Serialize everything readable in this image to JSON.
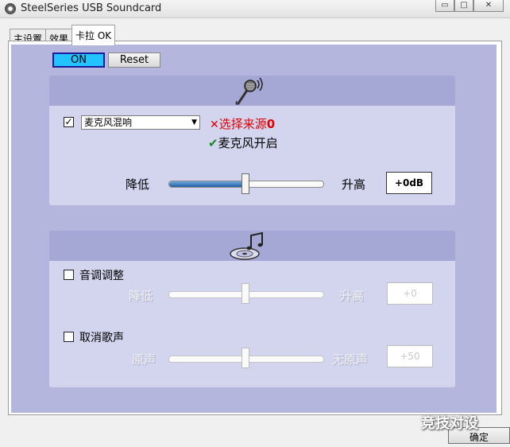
{
  "window": {
    "title": "SteelSeries USB Soundcard",
    "min": "▭",
    "max": "□",
    "close": "✕"
  },
  "tabs": [
    {
      "label": "主设置"
    },
    {
      "label": "效果"
    },
    {
      "label": "卡拉 OK"
    }
  ],
  "toolbar": {
    "on_label": "ON",
    "reset_label": "Reset"
  },
  "mic_section": {
    "enabled_checkbox": "✓",
    "select_value": "麦克风混响",
    "source_status": "选择来源",
    "source_mark": "✕",
    "source_count": "0",
    "mic_status": "麦克风开启",
    "mic_mark": "✔",
    "slider_low": "降低",
    "slider_high": "升高",
    "slider_value": "+0dB",
    "slider_level": 0.5
  },
  "music_section": {
    "pitch_label": "音调调整",
    "pitch_low": "降低",
    "pitch_high": "升高",
    "pitch_value": "+0",
    "pitch_level": 0.5,
    "vocal_label": "取消歌声",
    "vocal_low": "原声",
    "vocal_high": "无原声",
    "vocal_value": "+50",
    "vocal_level": 0.5
  },
  "footer": {
    "confirm_label": "确定",
    "watermark": "竞技对设"
  }
}
